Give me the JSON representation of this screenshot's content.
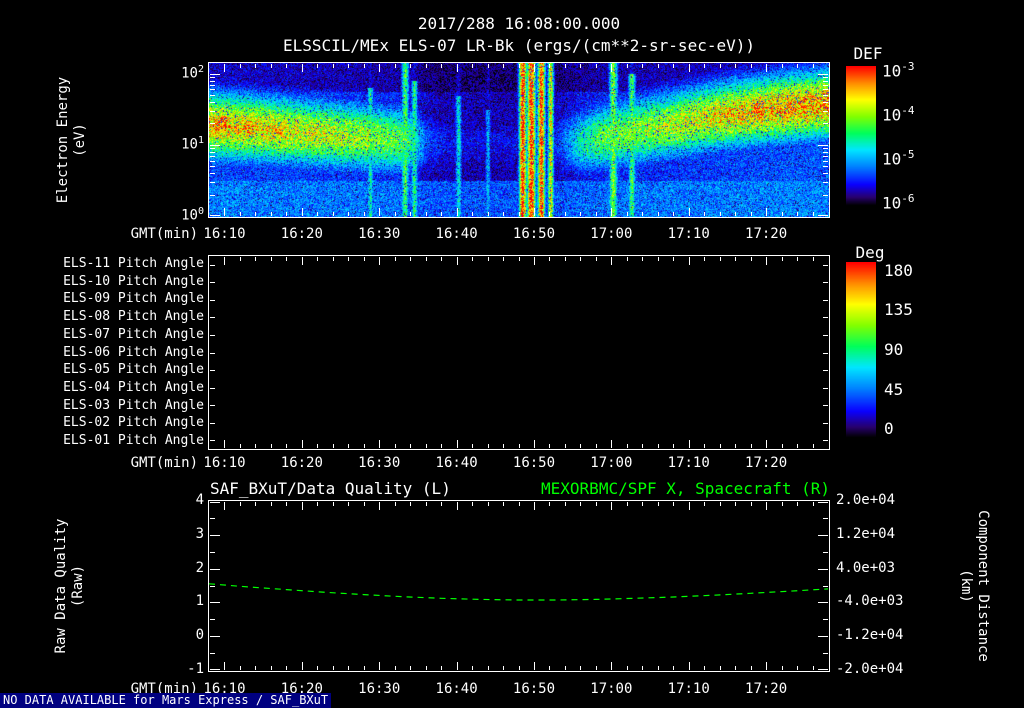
{
  "colors": {
    "background": "#000000",
    "foreground": "#ffffff",
    "green": "#00ff00",
    "footer_highlight": "#000080"
  },
  "header": {
    "title": "2017/288 16:08:00.000",
    "subtitle": "ELSSCIL/MEx ELS-07 LR-Bk (ergs/(cm**2-sr-sec-eV))"
  },
  "time_axis": {
    "label": "GMT(min)",
    "start_min_after_1600": 8,
    "end_min_after_1600": 88,
    "major_ticks": [
      {
        "t": 10,
        "label": "16:10"
      },
      {
        "t": 20,
        "label": "16:20"
      },
      {
        "t": 30,
        "label": "16:30"
      },
      {
        "t": 40,
        "label": "16:40"
      },
      {
        "t": 50,
        "label": "16:50"
      },
      {
        "t": 60,
        "label": "17:00"
      },
      {
        "t": 70,
        "label": "17:10"
      },
      {
        "t": 80,
        "label": "17:20"
      }
    ]
  },
  "chart_data": [
    {
      "type": "heatmap",
      "name": "electron-energy-spectrogram",
      "title": "ELSSCIL/MEx ELS-07 LR-Bk (ergs/(cm**2-sr-sec-eV))",
      "xlabel": "GMT(min)",
      "ylabel": "Electron Energy\n(eV)",
      "y_scale": "log",
      "y_decades": [
        0,
        1,
        2
      ],
      "y_log_max": 2.15,
      "colorbar": {
        "label": "DEF",
        "tick_exponents": [
          -3,
          -4,
          -5,
          -6
        ]
      },
      "colormap": [
        {
          "v": 0.0,
          "c": [
            0,
            0,
            0
          ]
        },
        {
          "v": 0.06,
          "c": [
            40,
            0,
            110
          ]
        },
        {
          "v": 0.15,
          "c": [
            10,
            0,
            255
          ]
        },
        {
          "v": 0.28,
          "c": [
            0,
            130,
            255
          ]
        },
        {
          "v": 0.4,
          "c": [
            0,
            230,
            255
          ]
        },
        {
          "v": 0.52,
          "c": [
            0,
            255,
            90
          ]
        },
        {
          "v": 0.64,
          "c": [
            130,
            255,
            0
          ]
        },
        {
          "v": 0.76,
          "c": [
            255,
            255,
            0
          ]
        },
        {
          "v": 0.87,
          "c": [
            255,
            150,
            0
          ]
        },
        {
          "v": 1.0,
          "c": [
            255,
            0,
            0
          ]
        }
      ],
      "model": {
        "description": "Bright 5-40 eV electron flux band 16:08-16:35, dark dropout 16:36-16:56 with intense full-range red burst columns near 16:48-16:52, flux band resuming 16:57 and rising to 30-60 eV with hot spots by 17:20",
        "band_width": 0.34,
        "band_center": [
          [
            8,
            1.28
          ],
          [
            16,
            1.22
          ],
          [
            24,
            1.15
          ],
          [
            32,
            1.08
          ],
          [
            40,
            1.02
          ],
          [
            48,
            1.0
          ],
          [
            56,
            1.05
          ],
          [
            62,
            1.18
          ],
          [
            68,
            1.3
          ],
          [
            74,
            1.42
          ],
          [
            80,
            1.5
          ],
          [
            88,
            1.58
          ]
        ],
        "band_amp": [
          [
            8,
            0.8
          ],
          [
            12,
            0.78
          ],
          [
            16,
            0.75
          ],
          [
            20,
            0.72
          ],
          [
            24,
            0.7
          ],
          [
            28,
            0.66
          ],
          [
            32,
            0.6
          ],
          [
            34,
            0.52
          ],
          [
            36,
            0.24
          ],
          [
            38,
            0.17
          ],
          [
            42,
            0.15
          ],
          [
            46,
            0.15
          ],
          [
            49,
            0.17
          ],
          [
            53,
            0.2
          ],
          [
            56,
            0.45
          ],
          [
            58,
            0.55
          ],
          [
            60,
            0.6
          ],
          [
            64,
            0.64
          ],
          [
            68,
            0.68
          ],
          [
            72,
            0.73
          ],
          [
            76,
            0.78
          ],
          [
            80,
            0.82
          ],
          [
            84,
            0.85
          ],
          [
            88,
            0.86
          ]
        ],
        "hot_spots": [
          {
            "t": 9.5,
            "log_e": 1.3,
            "amp": 0.95,
            "dt": 1.6,
            "dle": 0.18
          },
          {
            "t": 13,
            "log_e": 1.25,
            "amp": 0.9,
            "dt": 1.3,
            "dle": 0.16
          },
          {
            "t": 17,
            "log_e": 1.2,
            "amp": 0.85,
            "dt": 1.2,
            "dle": 0.15
          },
          {
            "t": 75,
            "log_e": 1.45,
            "amp": 0.88,
            "dt": 1.4,
            "dle": 0.15
          },
          {
            "t": 79,
            "log_e": 1.5,
            "amp": 0.95,
            "dt": 1.6,
            "dle": 0.16
          },
          {
            "t": 83,
            "log_e": 1.55,
            "amp": 0.9,
            "dt": 1.3,
            "dle": 0.15
          }
        ],
        "columns": [
          {
            "t": 28.8,
            "w": 0.3,
            "amp": 0.45,
            "top": 1.8
          },
          {
            "t": 33.3,
            "w": 0.35,
            "amp": 0.55,
            "top": 2.15
          },
          {
            "t": 34.5,
            "w": 0.3,
            "amp": 0.5,
            "top": 1.9
          },
          {
            "t": 40.2,
            "w": 0.3,
            "amp": 0.42,
            "top": 1.7
          },
          {
            "t": 44.0,
            "w": 0.25,
            "amp": 0.35,
            "top": 1.5
          },
          {
            "t": 48.5,
            "w": 0.35,
            "amp": 1.0,
            "top": 2.15
          },
          {
            "t": 49.6,
            "w": 0.4,
            "amp": 1.0,
            "top": 2.15
          },
          {
            "t": 50.9,
            "w": 0.35,
            "amp": 0.95,
            "top": 2.15
          },
          {
            "t": 52.1,
            "w": 0.28,
            "amp": 0.75,
            "top": 2.15
          },
          {
            "t": 60.2,
            "w": 0.4,
            "amp": 0.62,
            "top": 2.15
          },
          {
            "t": 62.6,
            "w": 0.35,
            "amp": 0.55,
            "top": 2.0
          }
        ],
        "low_floor": {
          "below_log_e": 0.5,
          "level": 0.22
        },
        "noise": 0.16
      }
    },
    {
      "type": "heatmap",
      "name": "pitch-angle-panel",
      "rows": [
        "ELS-11 Pitch Angle",
        "ELS-10 Pitch Angle",
        "ELS-09 Pitch Angle",
        "ELS-08 Pitch Angle",
        "ELS-07 Pitch Angle",
        "ELS-06 Pitch Angle",
        "ELS-05 Pitch Angle",
        "ELS-04 Pitch Angle",
        "ELS-03 Pitch Angle",
        "ELS-02 Pitch Angle",
        "ELS-01 Pitch Angle"
      ],
      "xlabel": "GMT(min)",
      "data": "empty - no pitch angle data plotted",
      "colorbar": {
        "label": "Deg",
        "ticks": [
          180,
          135,
          90,
          45,
          0
        ]
      }
    },
    {
      "type": "line",
      "name": "data-quality-and-spacecraft-distance",
      "title_left": "SAF_BXuT/Data Quality (L)",
      "title_right": "MEXORBMC/SPF X, Spacecraft (R)",
      "xlabel": "GMT(min)",
      "ylabel_left": "Raw Data Quality\n(Raw)",
      "ylabel_right": "Component Distance\n(km)",
      "ylim_left": [
        -1,
        4
      ],
      "yticks_left": [
        4,
        3,
        2,
        1,
        0,
        -1
      ],
      "yticks_right": [
        "2.0e+04",
        "1.2e+04",
        "4.0e+03",
        "-4.0e+03",
        "-1.2e+04",
        "-2.0e+04"
      ],
      "series": [
        {
          "name": "MEXORBMC/SPF X Spacecraft",
          "color": "#00ff00",
          "style": "dashed",
          "x_min_after_1600": [
            8,
            13,
            18,
            23,
            28,
            33,
            38,
            43,
            48,
            53,
            58,
            63,
            68,
            73,
            78,
            83,
            88
          ],
          "y_left_axis_units": [
            1.55,
            1.46,
            1.38,
            1.3,
            1.23,
            1.17,
            1.12,
            1.09,
            1.07,
            1.07,
            1.09,
            1.12,
            1.16,
            1.21,
            1.27,
            1.33,
            1.4
          ]
        }
      ]
    }
  ],
  "footer": {
    "no_data_text": "NO DATA AVAILABLE for Mars Express / SAF_BXuT"
  }
}
